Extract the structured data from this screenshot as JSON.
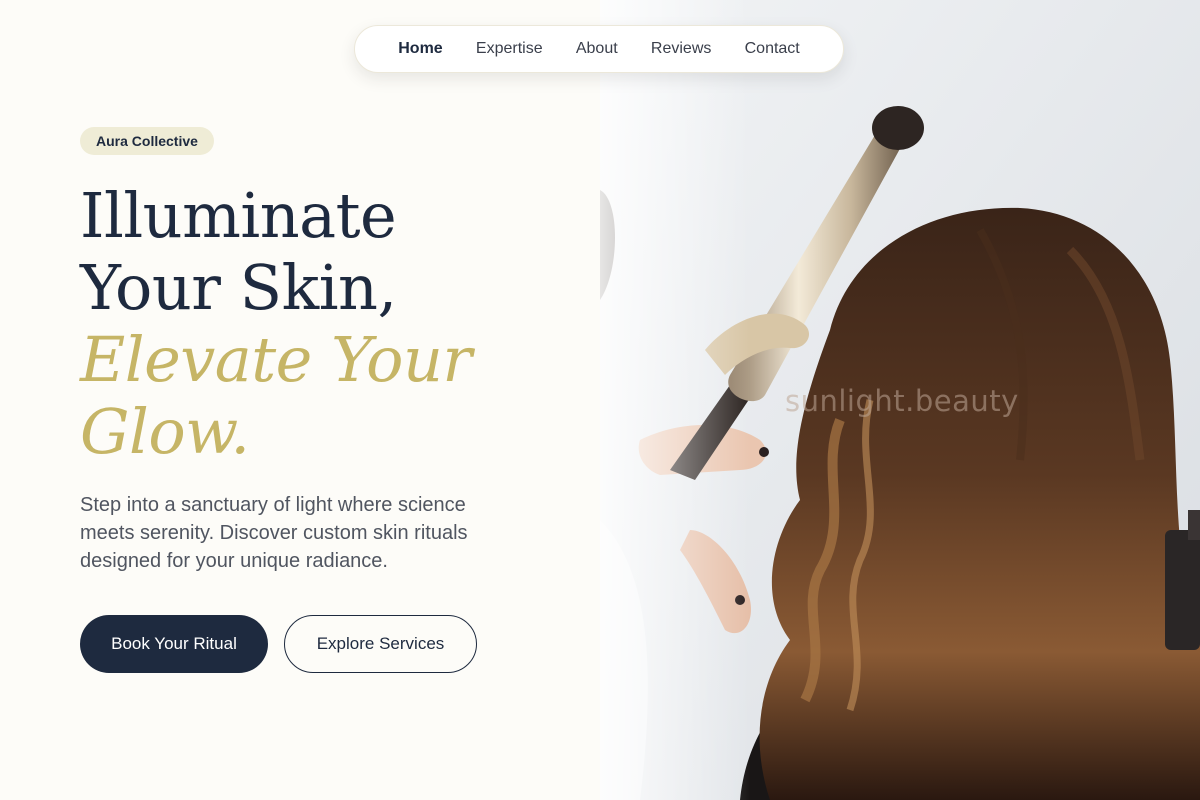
{
  "nav": {
    "items": [
      {
        "label": "Home",
        "active": true
      },
      {
        "label": "Expertise",
        "active": false
      },
      {
        "label": "About",
        "active": false
      },
      {
        "label": "Reviews",
        "active": false
      },
      {
        "label": "Contact",
        "active": false
      }
    ]
  },
  "hero": {
    "badge": "Aura Collective",
    "headline_line1": "Illuminate",
    "headline_line2": "Your Skin,",
    "headline_accent_line1": "Elevate Your",
    "headline_accent_line2": "Glow.",
    "subtext": "Step into a sanctuary of light where science meets serenity. Discover custom skin rituals designed for your unique radiance.",
    "primary_button": "Book Your Ritual",
    "secondary_button": "Explore Services"
  },
  "photo": {
    "watermark": "sunlight.beauty"
  },
  "colors": {
    "navy": "#1e2a3f",
    "gold": "#c6b566",
    "badge_bg": "#efecd6",
    "page_bg": "#fdfcf8"
  }
}
